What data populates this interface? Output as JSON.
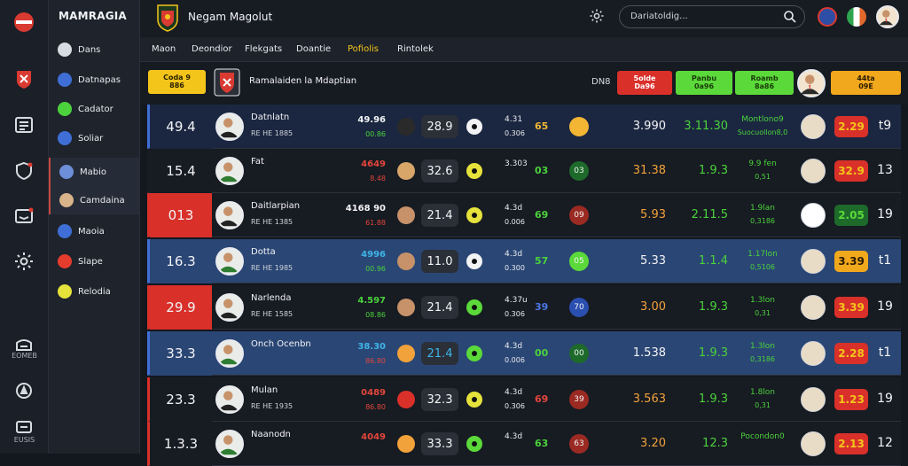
{
  "app": {
    "brand": "MAMRAGIA",
    "team_title": "Negam Magolut"
  },
  "rail": {
    "label_1": "EOMEB",
    "label_2": "EUSIS"
  },
  "nav": [
    {
      "label": "Dans",
      "icon": "trophy-icon",
      "color": "#d7dbe2"
    },
    {
      "label": "Datnapas",
      "icon": "globe-icon",
      "color": "#3f6fd6"
    },
    {
      "label": "Cadator",
      "icon": "check-icon",
      "color": "#4bd23c"
    },
    {
      "label": "Soliar",
      "icon": "avatar-icon",
      "color": "#3f6fd6"
    },
    {
      "label": "Mabio",
      "icon": "globe-icon",
      "color": "#6d8fd9"
    },
    {
      "label": "Camdaina",
      "icon": "avatar-icon",
      "color": "#d9b48a"
    },
    {
      "label": "Maoia",
      "icon": "globe-icon",
      "color": "#3f6fd6"
    },
    {
      "label": "Slape",
      "icon": "badge-icon",
      "color": "#e63c2e"
    },
    {
      "label": "Relodia",
      "icon": "ball-icon",
      "color": "#e6e23c"
    }
  ],
  "search": {
    "placeholder": "Dariatoldig..."
  },
  "tabs": [
    "Maon",
    "Deondior",
    "Flekgats",
    "Doantie",
    "Pofiolis",
    "Rintolek"
  ],
  "header": {
    "pill_yellow": "Coda 9\n886",
    "league": "Ramalaiden la Mdaptian",
    "dno": "DN8",
    "pill_red": "5olde\nDa96",
    "pill_green1": "Panbu\n0a96",
    "pill_green2": "Roamb\n8a86",
    "pill_orange": "44ta\n09E"
  },
  "rows": [
    {
      "rank": "49.4",
      "name": "Datnlatn",
      "sub": "RE HE 1885",
      "s1": "49.96",
      "s1b": "00.86",
      "s1b_color": "#4bd23c",
      "box": "28.9",
      "s2": "4.31",
      "s2b": "0.306",
      "s2c": "65",
      "s2c_color": "#f2b634",
      "circ": "",
      "v3": "3.990",
      "v3_color": "#f2f3f5",
      "v4": "3.11.30",
      "v4_color": "#4bd23c",
      "s5": "Montlono9",
      "s5b": "Suocuollon8,0",
      "s5_color": "#4bd23c",
      "pill": "2.29",
      "last": "t9"
    },
    {
      "rank": "15.4",
      "name": "Fat",
      "sub": "",
      "s1": "4649",
      "s1b": "8.48",
      "s1b_color": "#e2463b",
      "box": "32.6",
      "s2": "3.303",
      "s2b": "",
      "s2c": "03",
      "s2c_color": "#4bd23c",
      "circ": "03",
      "v3": "31.38",
      "v3_color": "#f2a23a",
      "v4": "1.9.3",
      "v4_color": "#4bd23c",
      "s5": "9.9 fen",
      "s5b": "0,51",
      "s5_color": "#4bd23c",
      "pill": "32.9",
      "last": "13"
    },
    {
      "rank": "013",
      "name": "Daitlarpian",
      "sub": "RE HE 1385",
      "s1": "4168 90",
      "s1b": "61.88",
      "s1b_color": "#e2463b",
      "box": "21.4",
      "s2": "4.3d",
      "s2b": "0.006",
      "s2c": "69",
      "s2c_color": "#4bd23c",
      "circ": "09",
      "v3": "5.93",
      "v3_color": "#f2a23a",
      "v4": "2.11.5",
      "v4_color": "#4bd23c",
      "s5": "1.9lan",
      "s5b": "0,3186",
      "s5_color": "#4bd23c",
      "pill": "2.05",
      "last": "19"
    },
    {
      "rank": "16.3",
      "name": "Dotta",
      "sub": "RE HE 1985",
      "s1": "4996",
      "s1b": "00.96",
      "s1b_color": "#4bd23c",
      "box": "11.0",
      "s2": "4.3d",
      "s2b": "0.300",
      "s2c": "57",
      "s2c_color": "#4bd23c",
      "circ": "05",
      "v3": "5.33",
      "v3_color": "#f2f3f5",
      "v4": "1.1.4",
      "v4_color": "#4bd23c",
      "s5": "1.17lon",
      "s5b": "0,5106",
      "s5_color": "#4bd23c",
      "pill": "3.39",
      "last": "t1"
    },
    {
      "rank": "29.9",
      "name": "Narlenda",
      "sub": "RE HE 1585",
      "s1": "4.597",
      "s1b": "08.86",
      "s1b_color": "#4bd23c",
      "box": "21.4",
      "s2": "4.37u",
      "s2b": "0.306",
      "s2c": "39",
      "s2c_color": "#4b76e6",
      "circ": "70",
      "v3": "3.00",
      "v3_color": "#f2a23a",
      "v4": "1.9.3",
      "v4_color": "#4bd23c",
      "s5": "1.3lon",
      "s5b": "0,31",
      "s5_color": "#4bd23c",
      "pill": "3.39",
      "last": "19"
    },
    {
      "rank": "33.3",
      "name": "Onch Ocenbn",
      "sub": "",
      "s1": "38.30",
      "s1b": "86.80",
      "s1b_color": "#e2463b",
      "box": "21.4",
      "s2": "4.3d",
      "s2b": "0.006",
      "s2c": "00",
      "s2c_color": "#4bd23c",
      "circ": "00",
      "v3": "1.538",
      "v3_color": "#f2f3f5",
      "v4": "1.9.3",
      "v4_color": "#4bd23c",
      "s5": "1.3lon",
      "s5b": "0,3186",
      "s5_color": "#4bd23c",
      "pill": "2.28",
      "last": "t1"
    },
    {
      "rank": "23.3",
      "name": "Mulan",
      "sub": "RE HE 1935",
      "s1": "0489",
      "s1b": "86.80",
      "s1b_color": "#e2463b",
      "box": "32.3",
      "s2": "4.3d",
      "s2b": "0.306",
      "s2c": "69",
      "s2c_color": "#e2463b",
      "circ": "39",
      "v3": "3.563",
      "v3_color": "#f2a23a",
      "v4": "1.9.3",
      "v4_color": "#4bd23c",
      "s5": "1.8lon",
      "s5b": "0,31",
      "s5_color": "#4bd23c",
      "pill": "1.23",
      "last": "19"
    },
    {
      "rank": "1.3.3",
      "name": "Naanodn",
      "sub": "",
      "s1": "4049",
      "s1b": "",
      "s1b_color": "#e2463b",
      "box": "33.3",
      "s2": "4.3d",
      "s2b": "",
      "s2c": "63",
      "s2c_color": "#4bd23c",
      "circ": "63",
      "v3": "3.20",
      "v3_color": "#f2a23a",
      "v4": "12.3",
      "v4_color": "#4bd23c",
      "s5": "Pocondon0",
      "s5b": "",
      "s5_color": "#4bd23c",
      "pill": "2.13",
      "last": "12"
    }
  ]
}
